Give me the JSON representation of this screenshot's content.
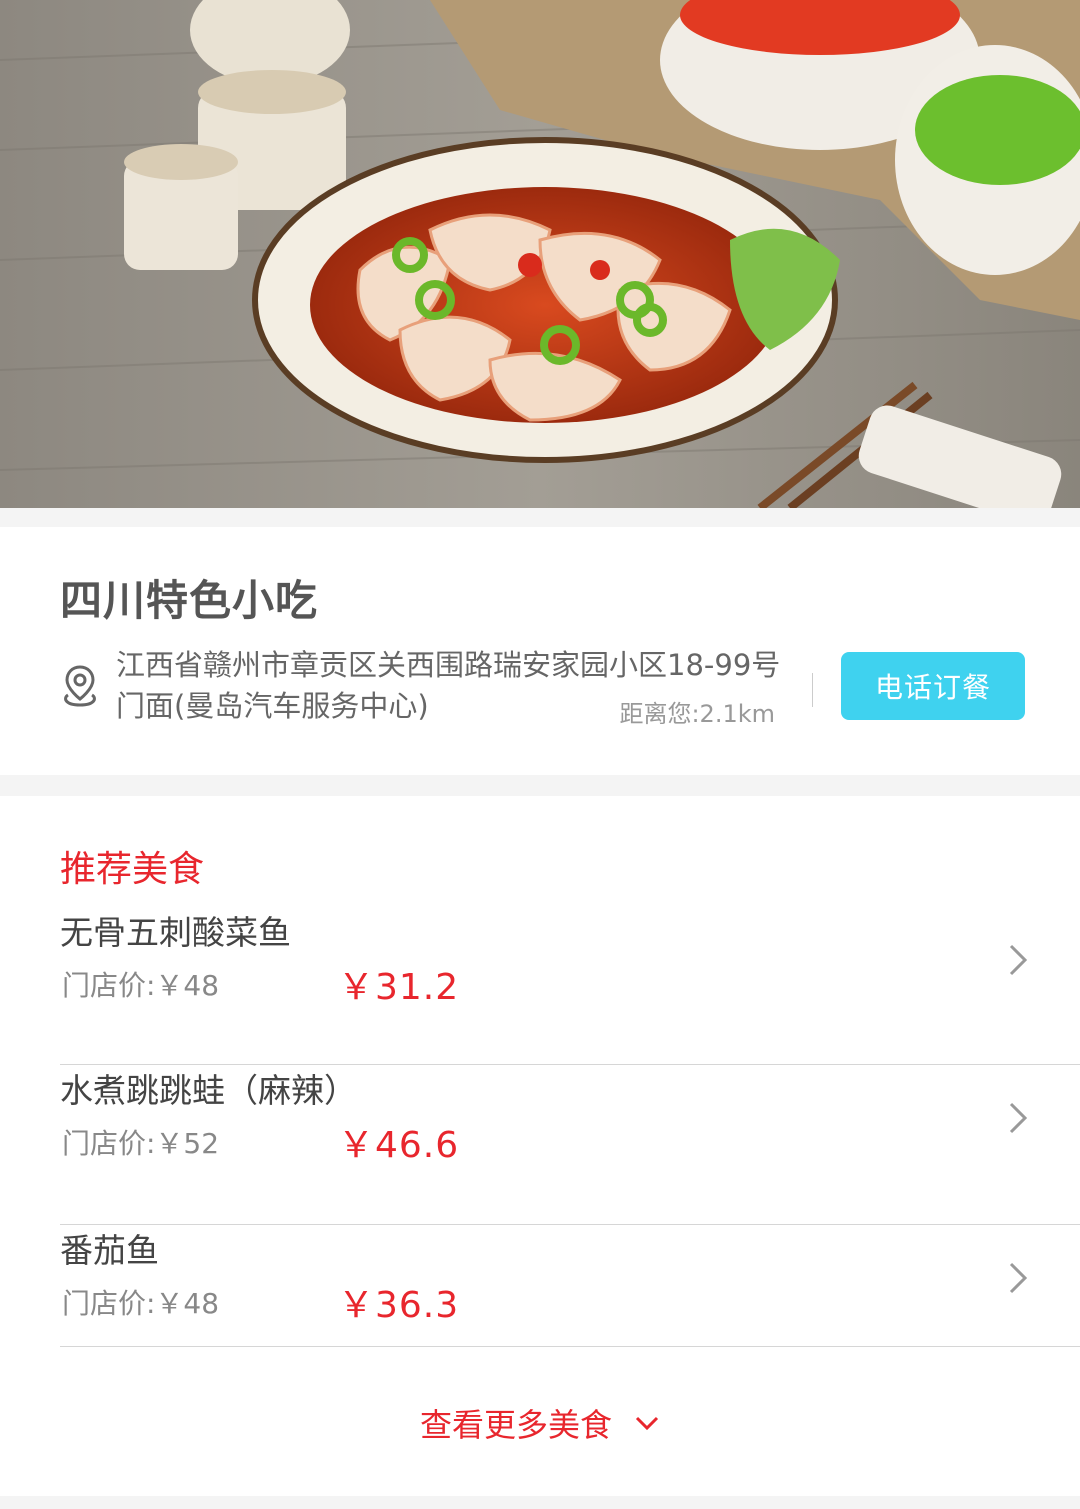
{
  "hero": {
    "image": "food-photo-dumplings-in-chili-oil"
  },
  "store": {
    "title": "四川特色小吃",
    "address": "江西省赣州市章贡区关西围路瑞安家园小区18-99号门面(曼岛汽车服务中心)",
    "distance": "距离您:2.1km",
    "call_button": "电话订餐",
    "icons": {
      "location": "location-pin-icon"
    }
  },
  "recommended": {
    "title": "推荐美食",
    "items": [
      {
        "name": "无骨五刺酸菜鱼",
        "store_price": "门店价:￥48",
        "price": "￥31.2"
      },
      {
        "name": "水煮跳跳蛙（麻辣）",
        "store_price": "门店价:￥52",
        "price": "￥46.6"
      },
      {
        "name": "番茄鱼",
        "store_price": "门店价:￥48",
        "price": "￥36.3"
      }
    ],
    "more": "查看更多美食"
  },
  "colors": {
    "accent": "#e8262d",
    "button": "#3fd2ef",
    "text": "#555555"
  }
}
